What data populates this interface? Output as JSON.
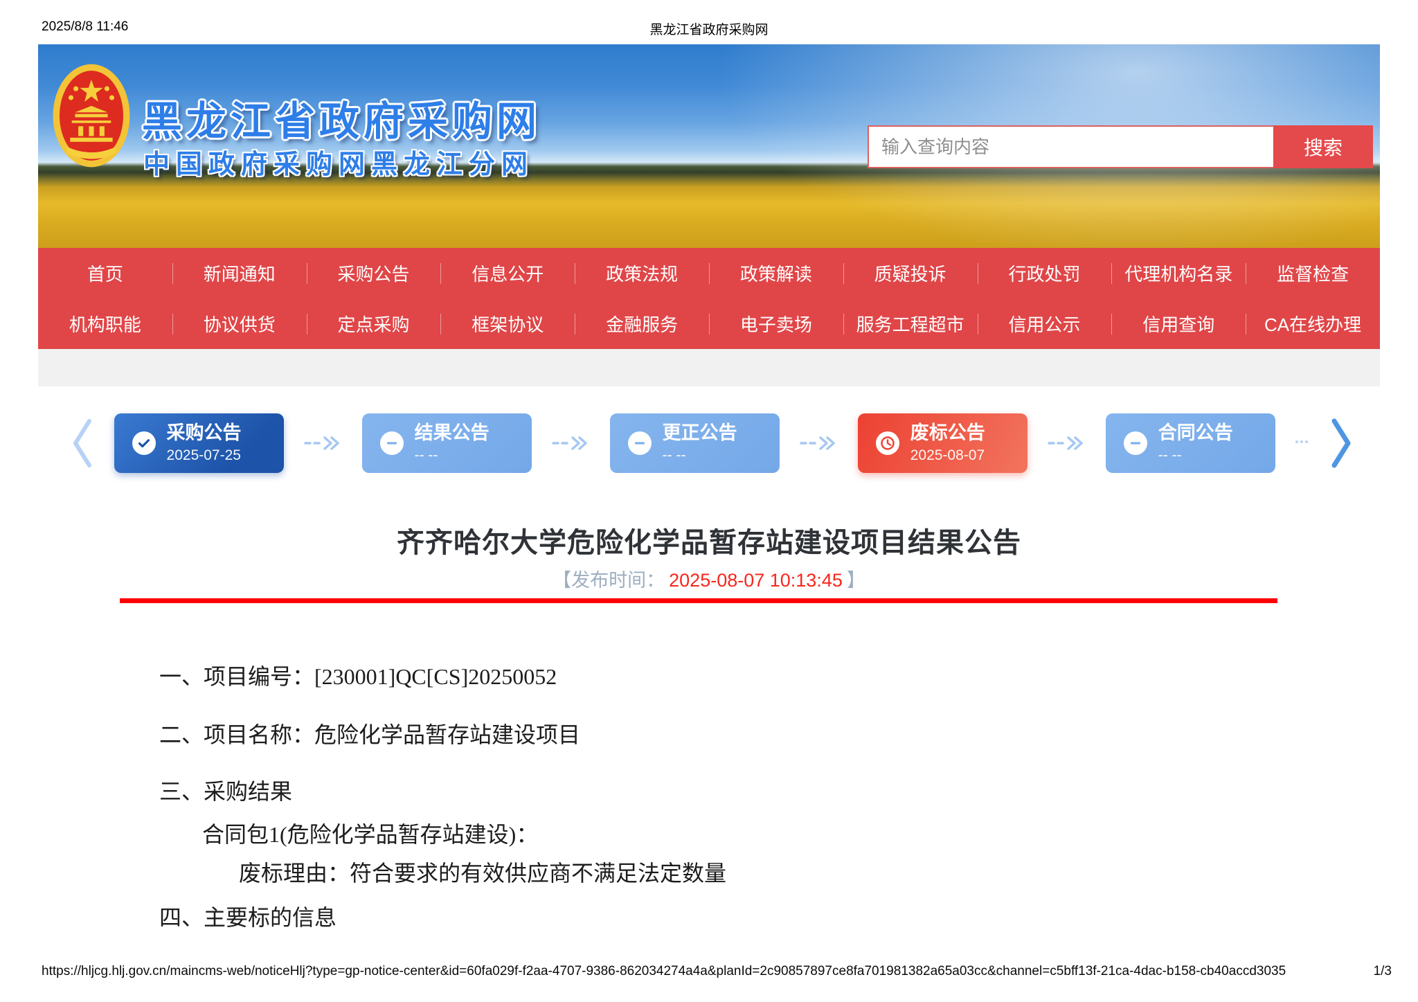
{
  "print_header": {
    "timestamp": "2025/8/8 11:46",
    "title": "黑龙江省政府采购网"
  },
  "banner": {
    "site_title": "黑龙江省政府采购网",
    "site_subtitle": "中国政府采购网黑龙江分网",
    "search": {
      "placeholder": "输入查询内容",
      "button_label": "搜索"
    }
  },
  "nav": {
    "row1": [
      "首页",
      "新闻通知",
      "采购公告",
      "信息公开",
      "政策法规",
      "政策解读",
      "质疑投诉",
      "行政处罚",
      "代理机构名录",
      "监督检查"
    ],
    "row2": [
      "机构职能",
      "协议供货",
      "定点采购",
      "框架协议",
      "金融服务",
      "电子卖场",
      "服务工程超市",
      "信用公示",
      "信用查询",
      "CA在线办理"
    ]
  },
  "timeline": {
    "steps": [
      {
        "label": "采购公告",
        "date": "2025-07-25",
        "state": "done",
        "icon": "check-circle-icon"
      },
      {
        "label": "结果公告",
        "date": "-- --",
        "state": "pending",
        "icon": "minus-circle-icon"
      },
      {
        "label": "更正公告",
        "date": "-- --",
        "state": "pending",
        "icon": "minus-circle-icon"
      },
      {
        "label": "废标公告",
        "date": "2025-08-07",
        "state": "void",
        "icon": "clock-icon"
      },
      {
        "label": "合同公告",
        "date": "-- --",
        "state": "pending",
        "icon": "minus-circle-icon"
      }
    ]
  },
  "article": {
    "title": "齐齐哈尔大学危险化学品暂存站建设项目结果公告",
    "publish_label": "【发布时间：",
    "publish_time": "2025-08-07 10:13:45",
    "publish_suffix": "】",
    "lines": [
      "一、项目编号：[230001]QC[CS]20250052",
      "二、项目名称：危险化学品暂存站建设项目",
      "三、采购结果",
      "合同包1(危险化学品暂存站建设)：",
      "废标理由：符合要求的有效供应商不满足法定数量",
      "四、主要标的信息"
    ]
  },
  "footer": {
    "url": "https://hljcg.hlj.gov.cn/maincms-web/noticeHlj?type=gp-notice-center&id=60fa029f-f2aa-4707-9386-862034274a4a&planId=2c90857897ce8fa701981382a65a03cc&channel=c5bff13f-21ca-4dac-b158-cb40accd3035",
    "page_indicator": "1/3"
  },
  "colors": {
    "nav_red": "#e04648",
    "search_button_red": "#e4494b",
    "done_step_blue": "#1d53a8",
    "pending_step_blue": "#7fb1ec",
    "void_step_red": "#ee4434",
    "publish_time_red": "#f6271c",
    "rule_red": "#fe0000",
    "site_title_blue": "#2d7ee8"
  }
}
